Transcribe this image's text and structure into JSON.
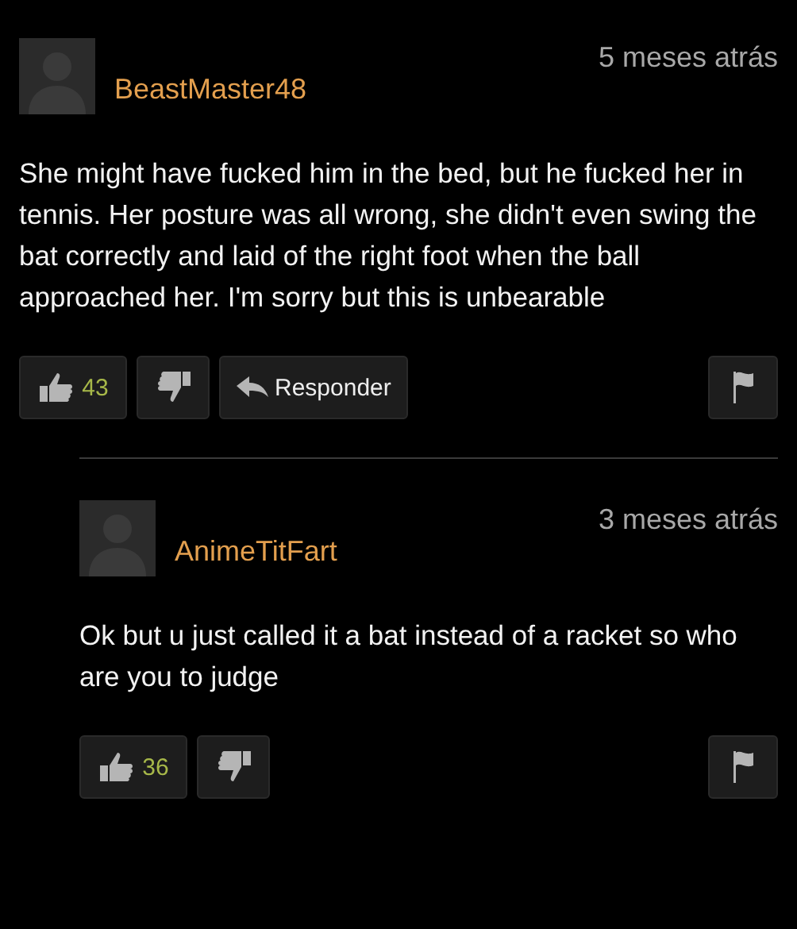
{
  "comments": [
    {
      "author": "BeastMaster48",
      "time": "5 meses atrás",
      "text": "She might have fucked him in the bed, but he fucked her in tennis. Her posture was all wrong, she didn't even swing the bat correctly and laid of the right foot when the ball approached her. I'm sorry but this is unbearable",
      "likes": "43",
      "reply_label": "Responder",
      "replies": [
        {
          "author": "AnimeTitFart",
          "time": "3 meses atrás",
          "text": "Ok but u just called it a bat instead of a racket so who are you to judge",
          "likes": "36"
        }
      ]
    }
  ]
}
